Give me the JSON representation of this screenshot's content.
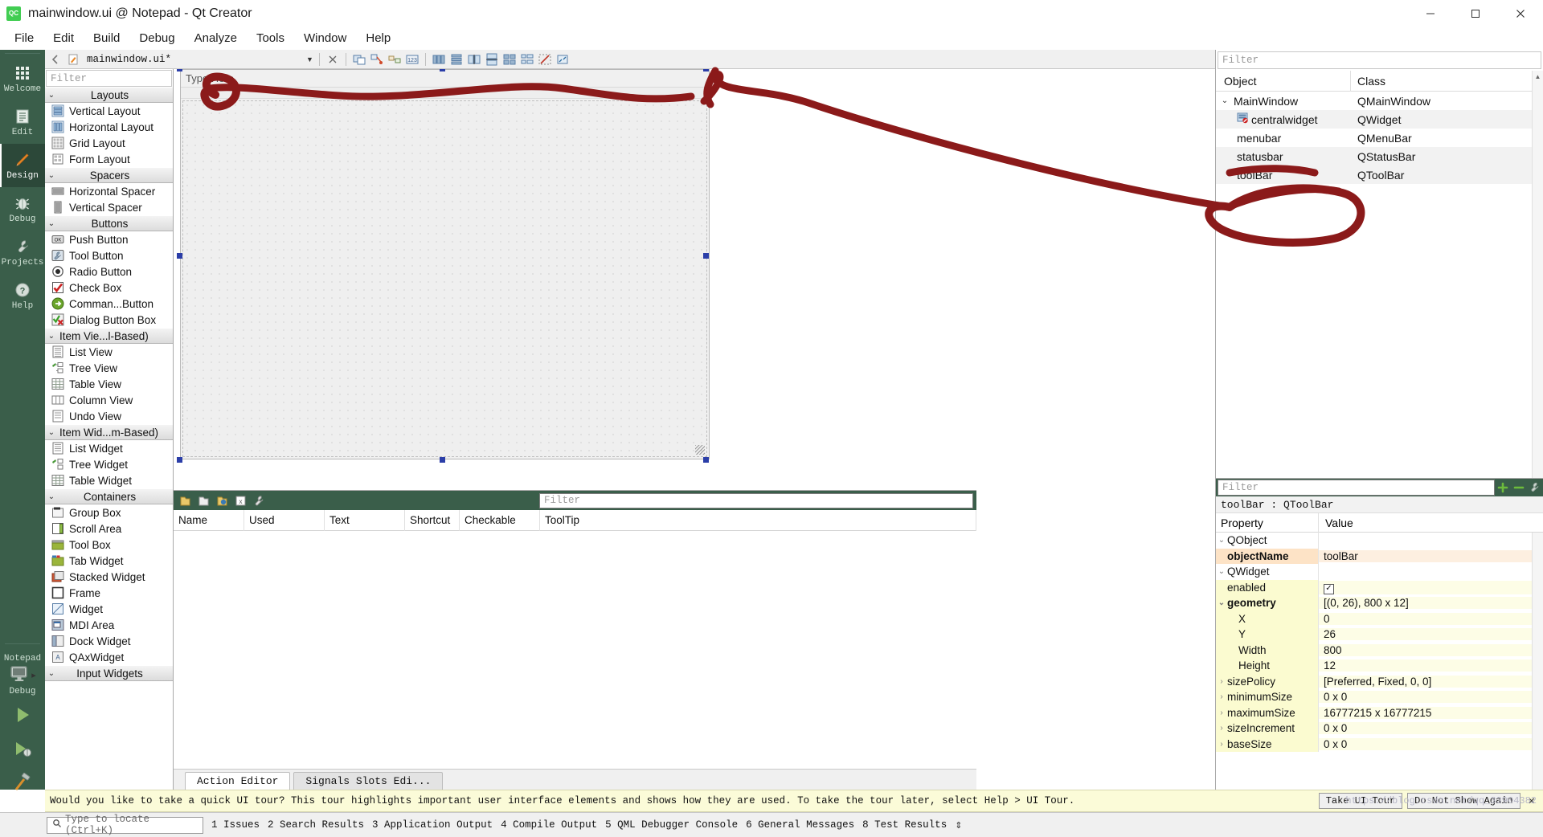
{
  "window": {
    "title": "mainwindow.ui @ Notepad - Qt Creator",
    "app_icon": "qt-creator-icon",
    "controls": {
      "minimize": "minimize-icon",
      "maximize": "maximize-icon",
      "close": "close-icon"
    }
  },
  "menubar": {
    "items": [
      "File",
      "Edit",
      "Build",
      "Debug",
      "Analyze",
      "Tools",
      "Window",
      "Help"
    ]
  },
  "modebar": {
    "modes": [
      {
        "label": "Welcome",
        "icon": "grid-icon",
        "active": false
      },
      {
        "label": "Edit",
        "icon": "document-icon",
        "active": false
      },
      {
        "label": "Design",
        "icon": "pencil-icon",
        "active": true
      },
      {
        "label": "Debug",
        "icon": "bug-icon",
        "active": false
      },
      {
        "label": "Projects",
        "icon": "wrench-icon",
        "active": false
      },
      {
        "label": "Help",
        "icon": "question-icon",
        "active": false
      }
    ],
    "kit": {
      "project": "Notepad",
      "run_config": "Debug",
      "icon": "desktop-icon"
    },
    "run_buttons": [
      {
        "name": "run-button",
        "icon": "play-icon"
      },
      {
        "name": "debug-button",
        "icon": "play-bug-icon"
      },
      {
        "name": "build-button",
        "icon": "hammer-icon"
      }
    ]
  },
  "editor_toolbar": {
    "file_name": "mainwindow.ui*",
    "file_icon": "ui-file-icon",
    "split_icon": "split-icon",
    "close_icon": "close-x-icon",
    "designer_tools": [
      "edit-widgets-icon",
      "edit-signals-slots-icon",
      "edit-buddies-icon",
      "edit-tab-order-icon",
      "layout-horizontally-icon",
      "layout-vertically-icon",
      "layout-splitter-h-icon",
      "layout-splitter-v-icon",
      "layout-grid-icon",
      "layout-form-icon",
      "break-layout-icon",
      "adjust-size-icon"
    ]
  },
  "widget_box": {
    "filter_placeholder": "Filter",
    "groups": [
      {
        "title": "Layouts",
        "centered": true,
        "items": [
          {
            "label": "Vertical Layout",
            "icon": "vertical-layout-icon"
          },
          {
            "label": "Horizontal Layout",
            "icon": "horizontal-layout-icon"
          },
          {
            "label": "Grid Layout",
            "icon": "grid-layout-icon"
          },
          {
            "label": "Form Layout",
            "icon": "form-layout-icon"
          }
        ]
      },
      {
        "title": "Spacers",
        "centered": true,
        "items": [
          {
            "label": "Horizontal Spacer",
            "icon": "horizontal-spacer-icon"
          },
          {
            "label": "Vertical Spacer",
            "icon": "vertical-spacer-icon"
          }
        ]
      },
      {
        "title": "Buttons",
        "centered": true,
        "items": [
          {
            "label": "Push Button",
            "icon": "push-button-icon"
          },
          {
            "label": "Tool Button",
            "icon": "tool-button-icon"
          },
          {
            "label": "Radio Button",
            "icon": "radio-button-icon"
          },
          {
            "label": "Check Box",
            "icon": "check-box-icon"
          },
          {
            "label": "Comman...Button",
            "icon": "command-link-button-icon"
          },
          {
            "label": "Dialog Button Box",
            "icon": "dialog-button-box-icon"
          }
        ]
      },
      {
        "title": "Item Vie...l-Based)",
        "centered": false,
        "items": [
          {
            "label": "List View",
            "icon": "list-view-icon"
          },
          {
            "label": "Tree View",
            "icon": "tree-view-icon"
          },
          {
            "label": "Table View",
            "icon": "table-view-icon"
          },
          {
            "label": "Column View",
            "icon": "column-view-icon"
          },
          {
            "label": "Undo View",
            "icon": "undo-view-icon"
          }
        ]
      },
      {
        "title": "Item Wid...m-Based)",
        "centered": false,
        "items": [
          {
            "label": "List Widget",
            "icon": "list-widget-icon"
          },
          {
            "label": "Tree Widget",
            "icon": "tree-widget-icon"
          },
          {
            "label": "Table Widget",
            "icon": "table-widget-icon"
          }
        ]
      },
      {
        "title": "Containers",
        "centered": true,
        "items": [
          {
            "label": "Group Box",
            "icon": "group-box-icon"
          },
          {
            "label": "Scroll Area",
            "icon": "scroll-area-icon"
          },
          {
            "label": "Tool Box",
            "icon": "tool-box-icon"
          },
          {
            "label": "Tab Widget",
            "icon": "tab-widget-icon"
          },
          {
            "label": "Stacked Widget",
            "icon": "stacked-widget-icon"
          },
          {
            "label": "Frame",
            "icon": "frame-icon"
          },
          {
            "label": "Widget",
            "icon": "widget-icon"
          },
          {
            "label": "MDI Area",
            "icon": "mdi-area-icon"
          },
          {
            "label": "Dock Widget",
            "icon": "dock-widget-icon"
          },
          {
            "label": "QAxWidget",
            "icon": "qax-widget-icon"
          }
        ]
      },
      {
        "title": "Input Widgets",
        "centered": true,
        "items": []
      }
    ]
  },
  "form_editor": {
    "menubar_hint": "Type Here",
    "selected": true
  },
  "action_editor": {
    "toolbar_icons": [
      "new-action-icon",
      "copy-action-icon",
      "edit-action-icon",
      "delete-action-icon",
      "view-options-icon"
    ],
    "filter_placeholder": "Filter",
    "columns": [
      "Name",
      "Used",
      "Text",
      "Shortcut",
      "Checkable",
      "ToolTip"
    ],
    "rows": [],
    "tabs": [
      {
        "label": "Action Editor",
        "active": true
      },
      {
        "label": "Signals Slots Edi...",
        "active": false
      }
    ]
  },
  "object_tree": {
    "filter_placeholder": "Filter",
    "columns": [
      "Object",
      "Class"
    ],
    "rows": [
      {
        "object": "MainWindow",
        "class": "QMainWindow",
        "indent": 0,
        "expandable": true,
        "icon": "",
        "selected": false
      },
      {
        "object": "centralwidget",
        "class": "QWidget",
        "indent": 1,
        "expandable": false,
        "icon": "central-widget-icon",
        "selected": true
      },
      {
        "object": "menubar",
        "class": "QMenuBar",
        "indent": 1,
        "expandable": false,
        "icon": "",
        "selected": false
      },
      {
        "object": "statusbar",
        "class": "QStatusBar",
        "indent": 1,
        "expandable": false,
        "icon": "",
        "selected": true
      },
      {
        "object": "toolBar",
        "class": "QToolBar",
        "indent": 1,
        "expandable": false,
        "icon": "",
        "selected": true
      }
    ]
  },
  "property_editor": {
    "filter_placeholder": "Filter",
    "add_icon": "plus-icon",
    "remove_icon": "minus-icon",
    "config_icon": "configure-icon",
    "object_line": "toolBar : QToolBar",
    "columns": [
      "Property",
      "Value"
    ],
    "rows": [
      {
        "kind": "group",
        "property": "QObject",
        "value": "",
        "indent": 0,
        "caret": "v"
      },
      {
        "kind": "orange",
        "property": "objectName",
        "value": "toolBar",
        "indent": 1,
        "caret": ""
      },
      {
        "kind": "group",
        "property": "QWidget",
        "value": "",
        "indent": 0,
        "caret": "v"
      },
      {
        "kind": "yellow",
        "property": "enabled",
        "value": "",
        "indent": 1,
        "caret": "",
        "checkbox": true
      },
      {
        "kind": "yellow",
        "property": "geometry",
        "value": "[(0, 26), 800 x 12]",
        "indent": 0,
        "caret": "v",
        "bold": true
      },
      {
        "kind": "yellow",
        "property": "X",
        "value": "0",
        "indent": 2,
        "caret": ""
      },
      {
        "kind": "yellow",
        "property": "Y",
        "value": "26",
        "indent": 2,
        "caret": ""
      },
      {
        "kind": "yellow",
        "property": "Width",
        "value": "800",
        "indent": 2,
        "caret": ""
      },
      {
        "kind": "yellow",
        "property": "Height",
        "value": "12",
        "indent": 2,
        "caret": ""
      },
      {
        "kind": "yellow",
        "property": "sizePolicy",
        "value": "[Preferred, Fixed, 0, 0]",
        "indent": 0,
        "caret": ">"
      },
      {
        "kind": "yellow",
        "property": "minimumSize",
        "value": "0 x 0",
        "indent": 0,
        "caret": ">"
      },
      {
        "kind": "yellow",
        "property": "maximumSize",
        "value": "16777215 x 16777215",
        "indent": 0,
        "caret": ">"
      },
      {
        "kind": "yellow",
        "property": "sizeIncrement",
        "value": "0 x 0",
        "indent": 0,
        "caret": ">"
      },
      {
        "kind": "yellow",
        "property": "baseSize",
        "value": "0 x 0",
        "indent": 0,
        "caret": ">"
      }
    ]
  },
  "banner": {
    "message": "Would you like to take a quick UI tour? This tour highlights important user interface elements and shows how they are used. To take the tour later, select Help > UI Tour.",
    "primary_button": "Take UI Tour",
    "secondary_button": "Do Not Show Again",
    "close_icon": "close-x-icon"
  },
  "statusbar": {
    "locator_placeholder": "Type to locate (Ctrl+K)",
    "search_icon": "search-icon",
    "panes": [
      "1 Issues",
      "2 Search Results",
      "3 Application Output",
      "4 Compile Output",
      "5 QML Debugger Console",
      "6 General Messages",
      "8 Test Results"
    ]
  },
  "watermark": "https://blog.csdn.net/qq_33904382",
  "colors": {
    "mode_bar": "#3a5e4a",
    "mode_active": "#2c4839",
    "selection": "#2b3ea8",
    "annotation": "#8b1a1a",
    "banner": "#fbfbd8",
    "property_group": "#9a9a9a",
    "property_orange": "#fde3c6",
    "property_yellow": "#fbfbd0"
  }
}
